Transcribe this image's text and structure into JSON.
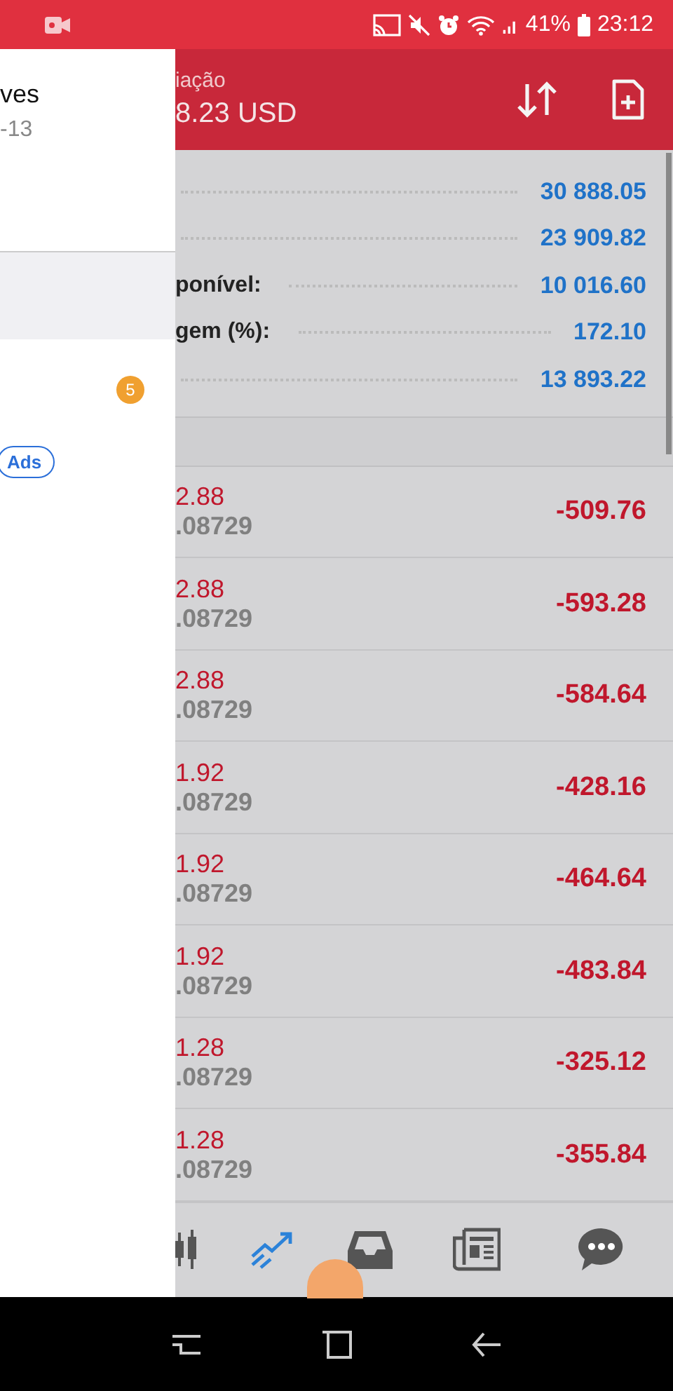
{
  "status_bar": {
    "battery": "41%",
    "time": "23:12"
  },
  "drawer": {
    "title": "ves",
    "subtitle": "-13",
    "items": [
      {
        "selected": true
      },
      {
        "selected": false,
        "badge": "5"
      },
      {
        "selected": false,
        "tag": "Ads"
      }
    ]
  },
  "header": {
    "label": "iação",
    "value": "8.23 USD"
  },
  "summary": [
    {
      "value": "30 888.05"
    },
    {
      "value": "23 909.82"
    },
    {
      "label": "ponível:",
      "value": "10 016.60"
    },
    {
      "label": "gem (%):",
      "value": "172.10"
    },
    {
      "value": "13 893.22"
    }
  ],
  "positions": [
    {
      "price": "2.88",
      "rate": ".08729",
      "profit": "-509.76"
    },
    {
      "price": "2.88",
      "rate": ".08729",
      "profit": "-593.28"
    },
    {
      "price": "2.88",
      "rate": ".08729",
      "profit": "-584.64"
    },
    {
      "price": "1.92",
      "rate": ".08729",
      "profit": "-428.16"
    },
    {
      "price": "1.92",
      "rate": ".08729",
      "profit": "-464.64"
    },
    {
      "price": "1.92",
      "rate": ".08729",
      "profit": "-483.84"
    },
    {
      "price": "1.28",
      "rate": ".08729",
      "profit": "-325.12"
    },
    {
      "price": "1.28",
      "rate": ".08729",
      "profit": "-355.84"
    }
  ],
  "bottom_nav": [
    {
      "kind": "candles",
      "selected": false
    },
    {
      "kind": "trade",
      "selected": true
    },
    {
      "kind": "inbox",
      "selected": false
    },
    {
      "kind": "news",
      "selected": false
    },
    {
      "kind": "chat",
      "selected": false
    }
  ]
}
